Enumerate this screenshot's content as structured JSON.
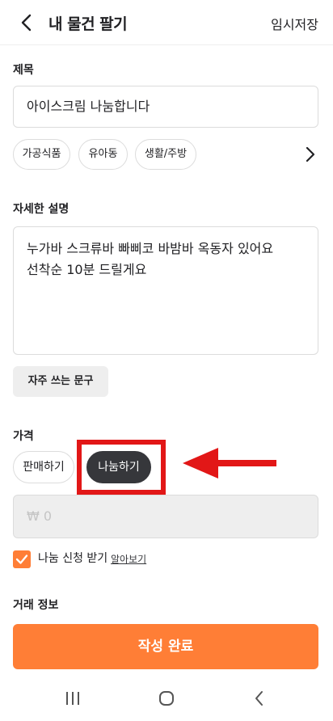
{
  "header": {
    "title": "내 물건 팔기",
    "save_draft": "임시저장"
  },
  "title_section": {
    "label": "제목",
    "value": "아이스크림 나눔합니다"
  },
  "category_chips": [
    "가공식품",
    "유아동",
    "생활/주방"
  ],
  "description_section": {
    "label": "자세한 설명",
    "value": "누가바 스크류바 빠삐코 바밤바 옥동자 있어요 선착순 10분 드릴게요",
    "frequent_phrases_button": "자주 쓰는 문구"
  },
  "price_section": {
    "label": "가격",
    "trade_types": [
      "판매하기",
      "나눔하기"
    ],
    "selected_trade_type": "나눔하기",
    "price_placeholder": "₩ 0"
  },
  "share_request": {
    "checked": true,
    "label": "나눔 신청 받기",
    "learn_more": "알아보기"
  },
  "trade_info": {
    "label": "거래 정보"
  },
  "submit_button": "작성 완료",
  "colors": {
    "accent": "#ff7e36",
    "selected_chip": "#36373b",
    "annotation": "#e21717"
  }
}
